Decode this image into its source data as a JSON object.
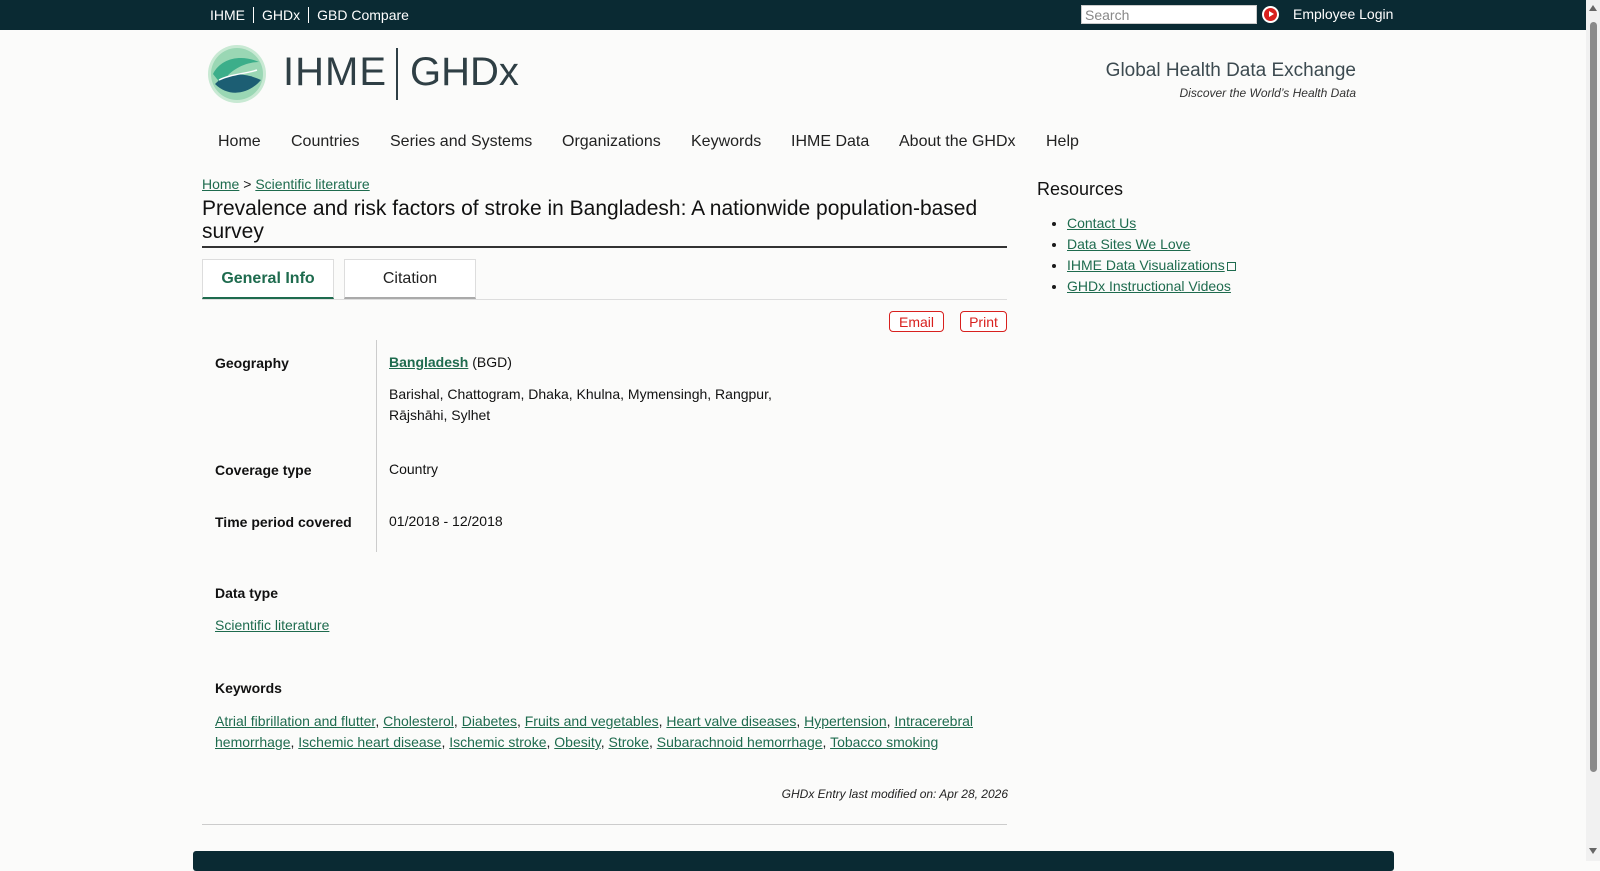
{
  "topbar": {
    "links": [
      "IHME",
      "GHDx",
      "GBD Compare"
    ],
    "search_placeholder": "Search",
    "login_label": "Employee Login"
  },
  "header": {
    "logo_ihme": "IHME",
    "logo_ghdx": "GHDx",
    "tagline_title": "Global Health Data Exchange",
    "tagline_sub": "Discover the World’s Health Data"
  },
  "nav": [
    "Home",
    "Countries",
    "Series and Systems",
    "Organizations",
    "Keywords",
    "IHME Data",
    "About the GHDx",
    "Help"
  ],
  "breadcrumb": {
    "home": "Home",
    "sep": ">",
    "section": "Scientific literature"
  },
  "page_title": "Prevalence and risk factors of stroke in Bangladesh: A nationwide population-based survey",
  "tabs": {
    "general": "General Info",
    "citation": "Citation"
  },
  "actions": {
    "email": "Email",
    "print": "Print"
  },
  "info": {
    "geography_label": "Geography",
    "geography_country": "Bangladesh",
    "geography_code": "(BGD)",
    "geography_regions": "Barishal, Chattogram, Dhaka, Khulna, Mymensingh, Rangpur,",
    "geography_regions2": "Rājshāhi, Sylhet",
    "coverage_label": "Coverage type",
    "coverage_value": "Country",
    "time_label": "Time period covered",
    "time_value": "01/2018 - 12/2018",
    "datatype_label": "Data type",
    "datatype_value": "Scientific literature",
    "keywords_label": "Keywords"
  },
  "keywords": [
    "Atrial fibrillation and flutter",
    "Cholesterol",
    "Diabetes",
    "Fruits and vegetables",
    "Heart valve diseases",
    "Hypertension",
    "Intracerebral hemorrhage",
    "Ischemic heart disease",
    "Ischemic stroke",
    "Obesity",
    "Stroke",
    "Subarachnoid hemorrhage",
    "Tobacco smoking"
  ],
  "modified": "GHDx Entry last modified on: Apr 28, 2026",
  "resources": {
    "title": "Resources",
    "items": [
      "Contact Us",
      "Data Sites We Love",
      "IHME Data Visualizations",
      "GHDx Instructional Videos"
    ]
  },
  "colors": {
    "topbar": "#0a2a33",
    "link": "#1e6b4e",
    "action": "#d8201e"
  }
}
